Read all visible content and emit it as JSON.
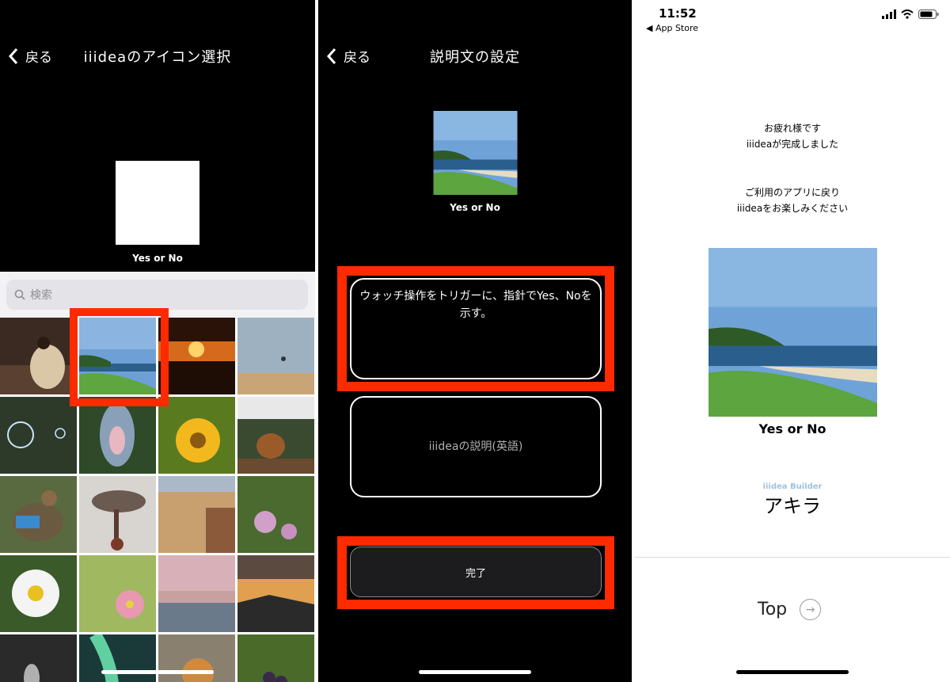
{
  "panel1": {
    "back_label": "戻る",
    "title": "iiideaのアイコン選択",
    "icon_caption": "Yes or No",
    "search_placeholder": "検索"
  },
  "panel2": {
    "back_label": "戻る",
    "title": "説明文の設定",
    "icon_caption": "Yes or No",
    "description_jp": "ウォッチ操作をトリガーに、指針でYes、Noを示す。",
    "description_en_placeholder": "iiideaの説明(英語)",
    "done_label": "完了"
  },
  "panel3": {
    "time": "11:52",
    "back_app": "◀ App Store",
    "message1_line1": "お疲れ様です",
    "message1_line2": "iiideaが完成しました",
    "message2_line1": "ご利用のアプリに戻り",
    "message2_line2": "iiideaをお楽しみください",
    "icon_caption": "Yes or No",
    "builder_label": "iiidea Builder",
    "builder_name": "アキラ",
    "top_label": "Top"
  },
  "colors": {
    "highlight": "#ff2a00",
    "builder_label": "#9cc3e0"
  }
}
